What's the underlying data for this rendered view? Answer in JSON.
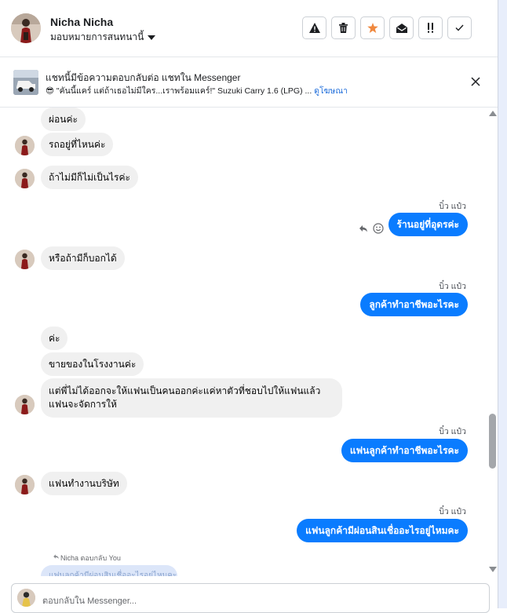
{
  "header": {
    "contact_name": "Nicha Nicha",
    "assign_label": "มอบหมายการสนทนานี้",
    "actions": [
      {
        "name": "spam-button",
        "icon": "warning-icon"
      },
      {
        "name": "delete-button",
        "icon": "trash-icon"
      },
      {
        "name": "star-button",
        "icon": "star-icon",
        "color": "#f0883e"
      },
      {
        "name": "mark-unread-button",
        "icon": "envelope-open-icon"
      },
      {
        "name": "follow-up-button",
        "icon": "double-exclamation-icon"
      },
      {
        "name": "done-button",
        "icon": "check-icon"
      }
    ]
  },
  "banner": {
    "title": "แชทนี้มีข้อความตอบกลับต่อ แชทใน Messenger",
    "emoji": "😎",
    "subtitle": "\"คันนี้แคร์ แต่ถ้าเธอไม่มีใคร...เราพร้อมแคร์!\" Suzuki Carry 1.6 (LPG) ...",
    "link": "ดูโฆษณา"
  },
  "messages": {
    "in_1": "ผ่อนค่ะ",
    "in_2": "รถอยู่ที่ไหนค่ะ",
    "in_3": "ถ้าไม่มีก็ไม่เป็นไรค่ะ",
    "out_1_sender": "บิ๋ว แป๋ว",
    "out_1": "ร้านอยู่ที่อุดรค่ะ",
    "in_4": "หรือถ้ามีก็บอกได้",
    "out_2_sender": "บิ๋ว แป๋ว",
    "out_2": "ลูกค้าทำอาชีพอะไรคะ",
    "in_5": "ค่ะ",
    "in_6": "ขายของในโรงงานค่ะ",
    "in_7": "แต่พี่ไม่ได้ออกจะให้แฟนเป็นคนออกค่ะแค่หาตัวที่ชอบไปให้แฟนแล้ว แฟนจะจัดการให้",
    "out_3_sender": "บิ๋ว แป๋ว",
    "out_3": "แฟนลูกค้าทำอาชีพอะไรคะ",
    "in_8": "แฟนทำงานบริษัท",
    "out_4_sender": "บิ๋ว แป๋ว",
    "out_4": "แฟนลูกค้ามีผ่อนสินเชื่ออะไรอยู่ไหมคะ",
    "reply_note": "Nicha ตอบกลับ You",
    "reply_preview": "แฟนลูกค้ามีผ่อนสินเชื่ออะไรอยู่ไหมคะ"
  },
  "composer": {
    "placeholder": "ตอบกลับใน Messenger..."
  },
  "colors": {
    "outgoing_bubble": "#0a7cff",
    "incoming_bubble": "#f0f0f0",
    "link": "#216fdb"
  }
}
